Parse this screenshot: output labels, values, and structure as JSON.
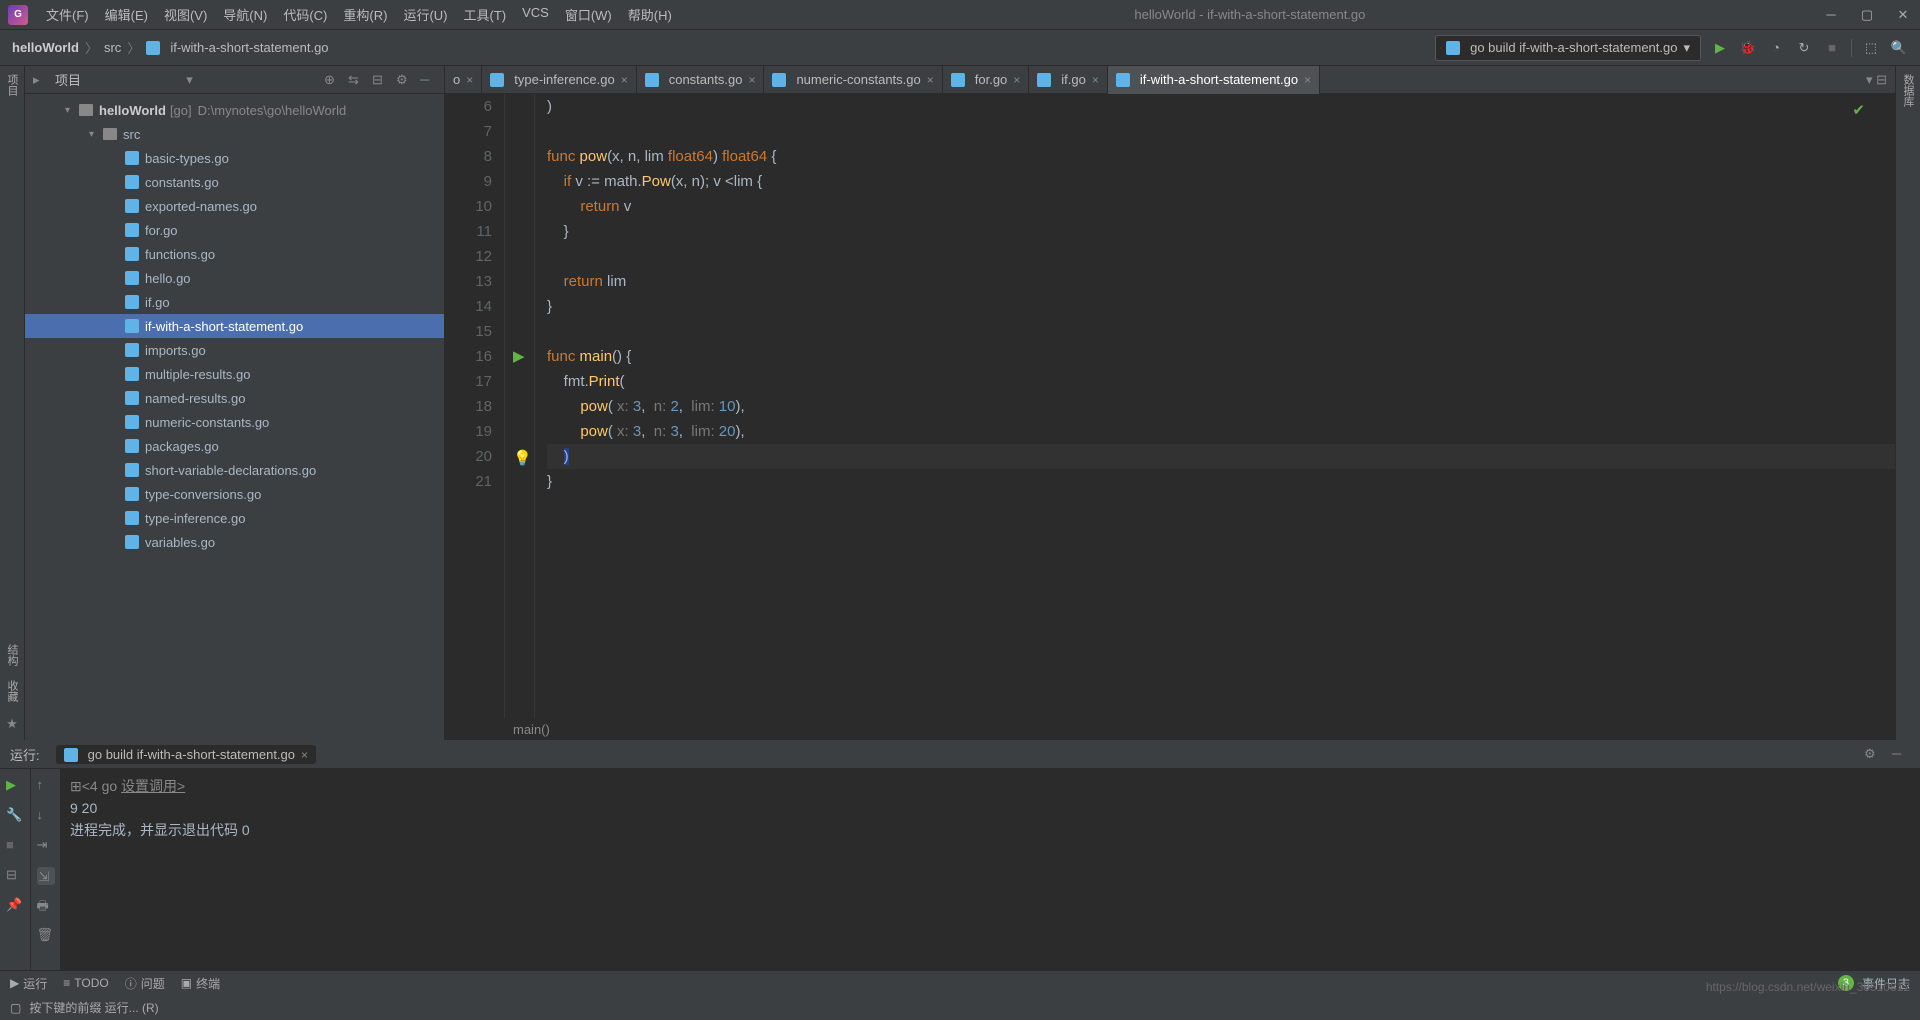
{
  "menu": [
    "文件(F)",
    "编辑(E)",
    "视图(V)",
    "导航(N)",
    "代码(C)",
    "重构(R)",
    "运行(U)",
    "工具(T)",
    "VCS",
    "窗口(W)",
    "帮助(H)"
  ],
  "title": "helloWorld - if-with-a-short-statement.go",
  "breadcrumb": {
    "project": "helloWorld",
    "folder": "src",
    "file": "if-with-a-short-statement.go"
  },
  "run_config": "go build if-with-a-short-statement.go",
  "project_panel": {
    "title": "项目",
    "root": "helloWorld",
    "root_type": "[go]",
    "root_path": "D:\\mynotes\\go\\helloWorld",
    "folder": "src",
    "files": [
      "basic-types.go",
      "constants.go",
      "exported-names.go",
      "for.go",
      "functions.go",
      "hello.go",
      "if.go",
      "if-with-a-short-statement.go",
      "imports.go",
      "multiple-results.go",
      "named-results.go",
      "numeric-constants.go",
      "packages.go",
      "short-variable-declarations.go",
      "type-conversions.go",
      "type-inference.go",
      "variables.go"
    ],
    "selected": "if-with-a-short-statement.go"
  },
  "tabs": [
    {
      "label": "o",
      "partial": true
    },
    {
      "label": "type-inference.go"
    },
    {
      "label": "constants.go"
    },
    {
      "label": "numeric-constants.go"
    },
    {
      "label": "for.go"
    },
    {
      "label": "if.go"
    },
    {
      "label": "if-with-a-short-statement.go",
      "active": true
    }
  ],
  "line_numbers": [
    6,
    7,
    8,
    9,
    10,
    11,
    12,
    13,
    14,
    15,
    16,
    17,
    18,
    19,
    20,
    21
  ],
  "code": {
    "l6": ")",
    "l8_kw": "func ",
    "l8_fn": "pow",
    "l8_rest1": "(x, n, lim ",
    "l8_type": "float64",
    "l8_rest2": ") ",
    "l8_type2": "float64",
    "l8_brace": " {",
    "l9_kw": "if ",
    "l9_rest1": "v := math.",
    "l9_fn": "Pow",
    "l9_rest2": "(x, n); v <lim {",
    "l10_kw": "return ",
    "l10_rest": "v",
    "l11": "}",
    "l13_kw": "return ",
    "l13_rest": "lim",
    "l14": "}",
    "l16_kw": "func ",
    "l16_fn": "main",
    "l16_rest": "() {",
    "l17_rest1": "fmt.",
    "l17_fn": "Print",
    "l17_rest2": "(",
    "l18_fn": "pow",
    "l18_h1": "x: ",
    "l18_n1": "3",
    "l18_h2": "n: ",
    "l18_n2": "2",
    "l18_h3": "lim: ",
    "l18_n3": "10",
    "l19_fn": "pow",
    "l19_h1": "x: ",
    "l19_n1": "3",
    "l19_h2": "n: ",
    "l19_n2": "3",
    "l19_h3": "lim: ",
    "l19_n3": "20",
    "l20": ")",
    "l21": "}"
  },
  "breadcrumb_bar": "main()",
  "run_panel": {
    "title": "运行:",
    "tab": "go build if-with-a-short-statement.go",
    "header_prefix": "<4 go ",
    "header_suffix": "设置调用>",
    "output": "9 20",
    "exit_msg": "进程完成，并显示退出代码 0"
  },
  "status_bar": {
    "run": "运行",
    "todo": "TODO",
    "problems": "问题",
    "terminal": "终端",
    "event_count": "3",
    "event_log": "事件日志",
    "hint": "按下键的前缀 运行... (R)"
  },
  "watermark": "https://blog.csdn.net/weixin_38510812",
  "right_label": "数据库"
}
